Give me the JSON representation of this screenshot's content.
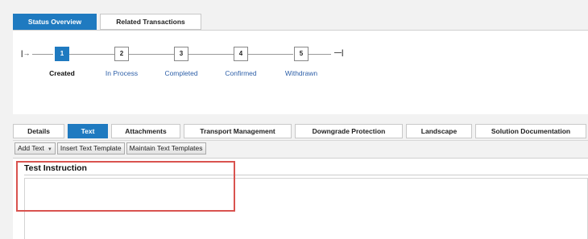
{
  "top_tabs": [
    "Status Overview",
    "Related Transactions"
  ],
  "status_steps": [
    {
      "number": "1",
      "label": "Created",
      "active": true
    },
    {
      "number": "2",
      "label": "In Process",
      "active": false
    },
    {
      "number": "3",
      "label": "Completed",
      "active": false
    },
    {
      "number": "4",
      "label": "Confirmed",
      "active": false
    },
    {
      "number": "5",
      "label": "Withdrawn",
      "active": false
    }
  ],
  "sub_tabs": [
    "Details",
    "Text",
    "Attachments",
    "Transport Management",
    "Downgrade Protection",
    "Landscape",
    "Solution Documentation"
  ],
  "toolbar": {
    "add_text": "Add Text",
    "insert_template": "Insert Text Template",
    "maintain_templates": "Maintain Text Templates"
  },
  "content": {
    "section_title": "Test Instruction",
    "text_value": ""
  },
  "colors": {
    "accent": "#1f7ac0",
    "link": "#2d5fa8",
    "highlight": "#d9534f"
  }
}
